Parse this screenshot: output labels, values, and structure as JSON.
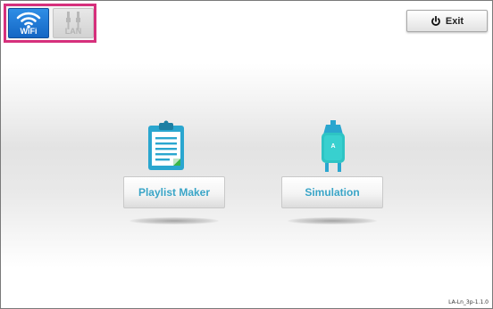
{
  "connection": {
    "wifi_label": "WiFi",
    "lan_label": "LAN",
    "selected": "WiFi",
    "wifi_icon": "wifi-icon",
    "lan_icon": "lan-plug-icon",
    "highlight_color": "#d6307c",
    "active_color": "#1f7ad6"
  },
  "toolbar": {
    "exit_label": "Exit",
    "exit_icon": "power-icon"
  },
  "features": {
    "playlist_maker": {
      "label": "Playlist Maker",
      "icon": "clipboard-document-icon"
    },
    "simulation": {
      "label": "Simulation",
      "icon": "iv-bag-icon"
    },
    "label_color": "#3aa5c7"
  },
  "footer": {
    "version": "LA-Ln_3p-1.1.0"
  }
}
